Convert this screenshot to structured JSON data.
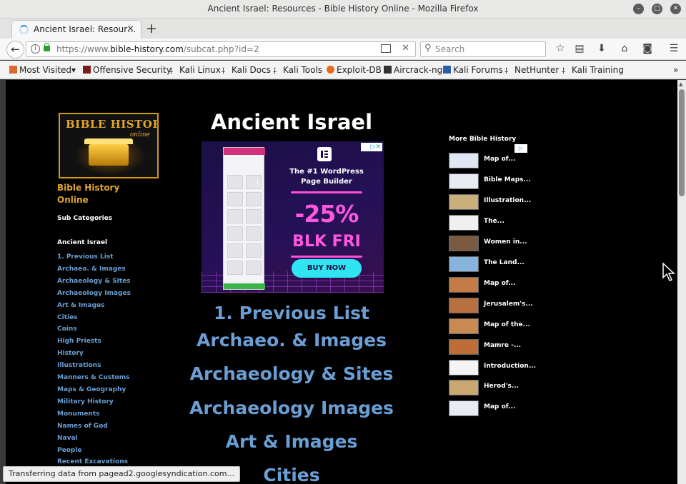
{
  "window": {
    "title": "Ancient Israel: Resources - Bible History Online - Mozilla Firefox"
  },
  "tab": {
    "label": "Ancient Israel: Resour…",
    "close": "×",
    "new_tab": "+"
  },
  "navbar": {
    "url_prefix": "https://www.",
    "url_domain": "bible-history.com",
    "url_path": "/subcat.php?id=2",
    "search_placeholder": "Search"
  },
  "bookmarks": [
    {
      "label": "Most Visited",
      "color": "#d96a2b",
      "chevron": "▾"
    },
    {
      "label": "Offensive Security",
      "color": "#7a1d1d"
    },
    {
      "label": "Kali Linux",
      "color": "#222222"
    },
    {
      "label": "Kali Docs",
      "color": "#222222"
    },
    {
      "label": "Kali Tools",
      "color": "#222222"
    },
    {
      "label": "Exploit-DB",
      "color": "#e46a1f"
    },
    {
      "label": "Aircrack-ng",
      "color": "#333333"
    },
    {
      "label": "Kali Forums",
      "color": "#2b5fa8"
    },
    {
      "label": "NetHunter",
      "color": "#222222"
    },
    {
      "label": "Kali Training",
      "color": "#222222"
    }
  ],
  "bookmarks_overflow": "»",
  "page": {
    "logo_line1": "BIBLE HISTORY",
    "logo_line2": "online",
    "site_name_1": "Bible History",
    "site_name_2": "Online",
    "sub_categories": "Sub Categories",
    "current_category": "Ancient Israel",
    "side_links": [
      "1. Previous List",
      "Archaeo. & Images",
      "Archaeology & Sites",
      "Archaeology Images",
      "Art & Images",
      "Cities",
      "Coins",
      "High Priests",
      "History",
      "Illustrations",
      "Manners & Customs",
      "Maps & Geography",
      "Military History",
      "Monuments",
      "Names of God",
      "Naval",
      "People",
      "Recent Excavations"
    ],
    "heading": "Ancient Israel",
    "ad": {
      "headline": "The #1 WordPress Page Builder",
      "discount": "-25%",
      "sale": "BLK FRI",
      "cta": "BUY NOW",
      "adchoices": "▷✕"
    },
    "main_links": [
      "1. Previous List",
      "Archaeo. & Images",
      "Archaeology & Sites",
      "Archaeology Images",
      "Art & Images",
      "Cities"
    ],
    "right_heading": "More Bible History",
    "right_badge": "▷",
    "right_items": [
      {
        "label": "Map of...",
        "color": "#dfe8f2"
      },
      {
        "label": "Bible Maps...",
        "color": "#e7ecf4"
      },
      {
        "label": "Illustration...",
        "color": "#c9b07a"
      },
      {
        "label": "The...",
        "color": "#f0f0f0"
      },
      {
        "label": "Women in...",
        "color": "#7a5a40"
      },
      {
        "label": "The Land...",
        "color": "#86b4dc"
      },
      {
        "label": "Map of...",
        "color": "#c47b45"
      },
      {
        "label": "Jerusalem's...",
        "color": "#b8703f"
      },
      {
        "label": "Map of the...",
        "color": "#c98a52"
      },
      {
        "label": "Mamre -...",
        "color": "#bd6e38"
      },
      {
        "label": "Introduction...",
        "color": "#f4f4f4"
      },
      {
        "label": "Herod's...",
        "color": "#c8a772"
      },
      {
        "label": "Map of...",
        "color": "#e7ecf4"
      }
    ]
  },
  "status": "Transferring data from pagead2.googlesyndication.com..."
}
